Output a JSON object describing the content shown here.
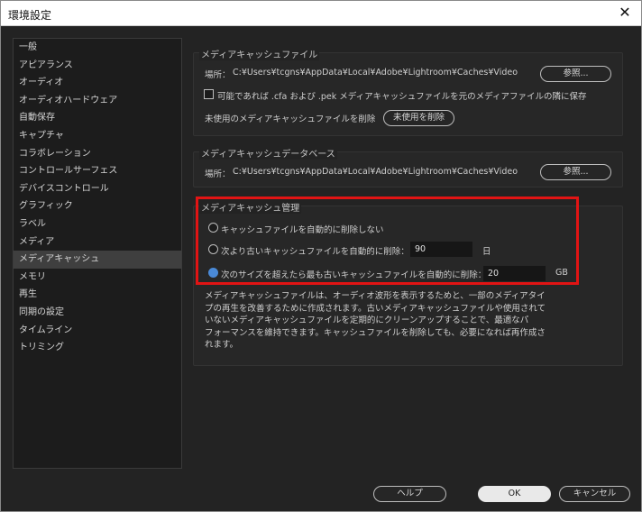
{
  "window": {
    "title": "環境設定"
  },
  "sidebar": {
    "items": [
      {
        "label": "一般",
        "selected": false
      },
      {
        "label": "アピアランス",
        "selected": false
      },
      {
        "label": "オーディオ",
        "selected": false
      },
      {
        "label": "オーディオハードウェア",
        "selected": false
      },
      {
        "label": "自動保存",
        "selected": false
      },
      {
        "label": "キャプチャ",
        "selected": false
      },
      {
        "label": "コラボレーション",
        "selected": false
      },
      {
        "label": "コントロールサーフェス",
        "selected": false
      },
      {
        "label": "デバイスコントロール",
        "selected": false
      },
      {
        "label": "グラフィック",
        "selected": false
      },
      {
        "label": "ラベル",
        "selected": false
      },
      {
        "label": "メディア",
        "selected": false
      },
      {
        "label": "メディアキャッシュ",
        "selected": true
      },
      {
        "label": "メモリ",
        "selected": false
      },
      {
        "label": "再生",
        "selected": false
      },
      {
        "label": "同期の設定",
        "selected": false
      },
      {
        "label": "タイムライン",
        "selected": false
      },
      {
        "label": "トリミング",
        "selected": false
      }
    ]
  },
  "cache_files": {
    "title": "メディアキャッシュファイル",
    "location_label": "場所：",
    "location_path": "C:¥Users¥tcgns¥AppData¥Local¥Adobe¥Lightroom¥Caches¥Video",
    "browse_label": "参照...",
    "save_next_label": "可能であれば .cfa および .pek メディアキャッシュファイルを元のメディアファイルの隣に保存",
    "save_next_checked": false,
    "delete_unused_label": "未使用のメディアキャッシュファイルを削除",
    "delete_unused_button": "未使用を削除"
  },
  "cache_db": {
    "title": "メディアキャッシュデータベース",
    "location_label": "場所：",
    "location_path": "C:¥Users¥tcgns¥AppData¥Local¥Adobe¥Lightroom¥Caches¥Video",
    "browse_label": "参照..."
  },
  "cache_mgmt": {
    "title": "メディアキャッシュ管理",
    "option_never": "キャッシュファイルを自動的に削除しない",
    "option_older": "次より古いキャッシュファイルを自動的に削除：",
    "older_value": "90",
    "older_unit": "日",
    "option_size": "次のサイズを超えたら最も古いキャッシュファイルを自動的に削除：",
    "size_value": "20",
    "size_unit": "GB",
    "selected_option": "size"
  },
  "description": {
    "lines": [
      "メディアキャッシュファイルは、オーディオ波形を表示するためと、一部のメディアタイ",
      "プの再生を改善するために作成されます。古いメディアキャッシュファイルや使用されて",
      "いないメディアキャッシュファイルを定期的にクリーンアップすることで、最適なパ",
      "フォーマンスを維持できます。キャッシュファイルを削除しても、必要になれば再作成さ",
      "れます。"
    ]
  },
  "footer": {
    "help_label": "ヘルプ",
    "ok_label": "OK",
    "cancel_label": "キャンセル"
  },
  "colors": {
    "highlight_border": "#e11414",
    "accent": "#4a8ad8",
    "background": "#232323"
  }
}
